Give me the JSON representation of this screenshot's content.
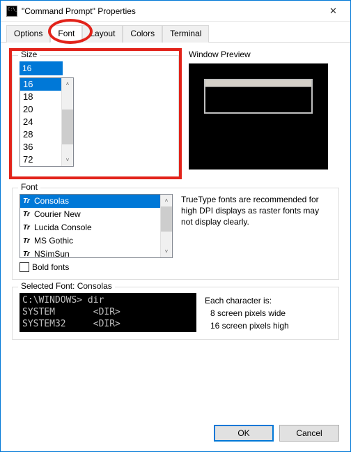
{
  "titlebar": {
    "title": "\"Command Prompt\" Properties"
  },
  "tabs": [
    "Options",
    "Font",
    "Layout",
    "Colors",
    "Terminal"
  ],
  "active_tab": 1,
  "size": {
    "label": "Size",
    "value": "16",
    "options": [
      "16",
      "18",
      "20",
      "24",
      "28",
      "36",
      "72"
    ]
  },
  "preview": {
    "label": "Window Preview"
  },
  "font": {
    "label": "Font",
    "options": [
      "Consolas",
      "Courier New",
      "Lucida Console",
      "MS Gothic",
      "NSimSun"
    ],
    "selected": 0,
    "info": "TrueType fonts are recommended for high DPI displays as raster fonts may not display clearly.",
    "bold_label": "Bold fonts"
  },
  "selected_font": {
    "label": "Selected Font: Consolas",
    "console_lines": [
      "C:\\WINDOWS> dir",
      "SYSTEM       <DIR>",
      "SYSTEM32     <DIR>"
    ],
    "char_intro": "Each character is:",
    "char_w": "  8 screen pixels wide",
    "char_h": "16 screen pixels high"
  },
  "buttons": {
    "ok": "OK",
    "cancel": "Cancel"
  }
}
